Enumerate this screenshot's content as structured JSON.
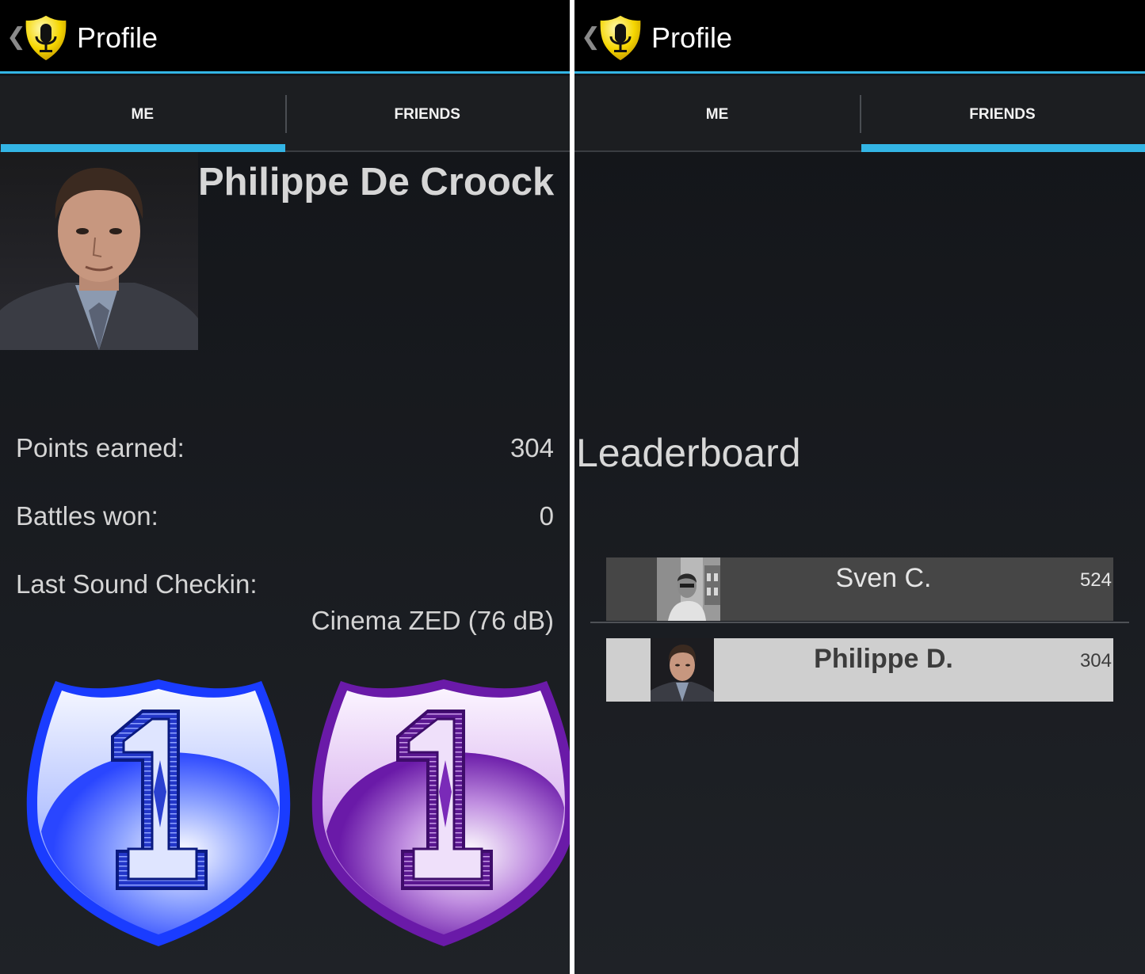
{
  "app": {
    "title": "Profile",
    "icon": "shield-microphone-icon",
    "accent_color": "#33b5e5"
  },
  "tabs": [
    {
      "label": "ME"
    },
    {
      "label": "FRIENDS"
    }
  ],
  "me": {
    "name": "Philippe De Croock",
    "stats": {
      "points_label": "Points earned:",
      "points_value": "304",
      "battles_label": "Battles won:",
      "battles_value": "0",
      "checkin_label": "Last Sound Checkin:",
      "checkin_value": "Cinema ZED (76 dB)"
    },
    "badges": [
      {
        "icon": "number-one-shield-icon",
        "color": "#1a3cff"
      },
      {
        "icon": "number-one-shield-icon",
        "color": "#6a1aa8"
      }
    ]
  },
  "friends": {
    "title": "Leaderboard",
    "entries": [
      {
        "name": "Sven C.",
        "score": "524"
      },
      {
        "name": "Philippe D.",
        "score": "304"
      }
    ]
  }
}
